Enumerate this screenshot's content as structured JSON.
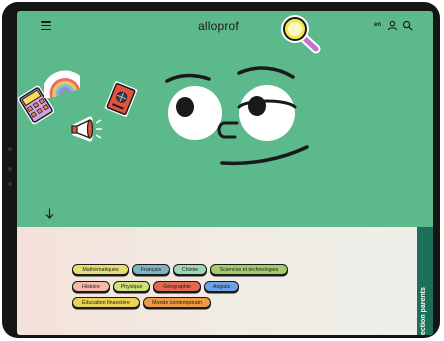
{
  "header": {
    "logo_text": "alloprof",
    "lang_label": "en",
    "menu_icon": "hamburger-menu-icon",
    "account_icon": "user-icon",
    "search_icon": "search-icon"
  },
  "hero": {
    "background_color": "#5cb98b",
    "stickers": [
      "magnifying-glass-sticker",
      "calculator-sticker",
      "rainbow-sticker",
      "passport-sticker",
      "megaphone-sticker"
    ],
    "mascot": "green-face-mascot",
    "scroll_icon": "arrow-down-icon"
  },
  "subjects": [
    {
      "label": "Mathématiques",
      "color": "#e7dc6f"
    },
    {
      "label": "Français",
      "color": "#7fb5c3"
    },
    {
      "label": "Chimie",
      "color": "#9fd6b4"
    },
    {
      "label": "Sciences et technologies",
      "color": "#a3cc68"
    },
    {
      "label": "Histoire",
      "color": "#f3b9a8"
    },
    {
      "label": "Physique",
      "color": "#cfe07a"
    },
    {
      "label": "Géographie",
      "color": "#e2684e"
    },
    {
      "label": "Anglais",
      "color": "#6fa0e8"
    },
    {
      "label": "Éducation financière",
      "color": "#e9d255"
    },
    {
      "label": "Monde contemporain",
      "color": "#ec9a43"
    }
  ],
  "side_tab": {
    "label": "ection parents"
  }
}
